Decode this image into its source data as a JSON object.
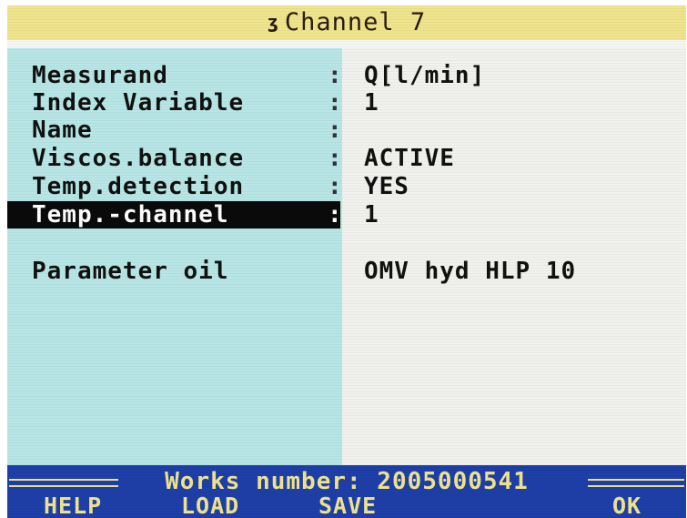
{
  "title": {
    "marker": "ʒ",
    "text": "Channel 7"
  },
  "fields": [
    {
      "label": "Measurand",
      "separator": ":",
      "value": "Q[l/min]"
    },
    {
      "label": "Index Variable",
      "separator": ":",
      "value": "1"
    },
    {
      "label": "Name",
      "separator": ":",
      "value": ""
    },
    {
      "label": "Viscos.balance",
      "separator": ":",
      "value": "ACTIVE"
    },
    {
      "label": "Temp.detection",
      "separator": ":",
      "value": "YES"
    },
    {
      "label": "Temp.-channel",
      "separator": ":",
      "value": "1",
      "selected": true
    }
  ],
  "parameter_oil": {
    "label": "Parameter oil",
    "value": "OMV hyd HLP 10"
  },
  "status": {
    "works_number_text": "Works number: 2005000541"
  },
  "softkeys": {
    "help": "HELP",
    "load": "LOAD",
    "save": "SAVE",
    "ok": "OK"
  },
  "colors": {
    "title_bar": "#f0e48c",
    "left_panel": "#b8e6e6",
    "right_panel": "#f1f1ed",
    "status_bar": "#1e3fa8",
    "status_text": "#f0e48c",
    "selection": "#0a0a0a"
  }
}
